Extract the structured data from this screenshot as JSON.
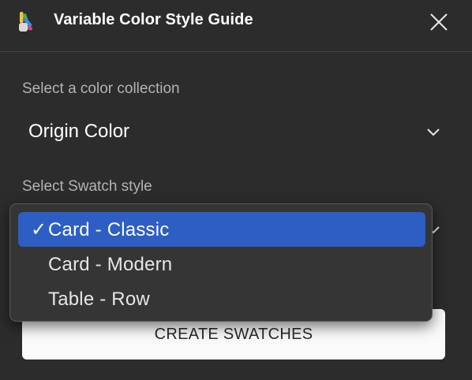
{
  "window": {
    "title": "Variable Color Style Guide",
    "icons": {
      "logo": "plugin-logo-icon",
      "close": "close-icon"
    }
  },
  "collection": {
    "label": "Select a color collection",
    "selected_value": "Origin Color",
    "icon": "chevron-down-icon"
  },
  "swatch_style": {
    "label": "Select Swatch style",
    "options": [
      "Card - Classic",
      "Card - Modern",
      "Table - Row"
    ],
    "selected_index": 0,
    "check_mark": "✓"
  },
  "actions": {
    "create_label": "CREATE SWATCHES"
  },
  "colors": {
    "background": "#2c2c2c",
    "highlight": "#2d5ec4",
    "label_text": "#b3b3b3",
    "button_bg": "#fafafa"
  }
}
